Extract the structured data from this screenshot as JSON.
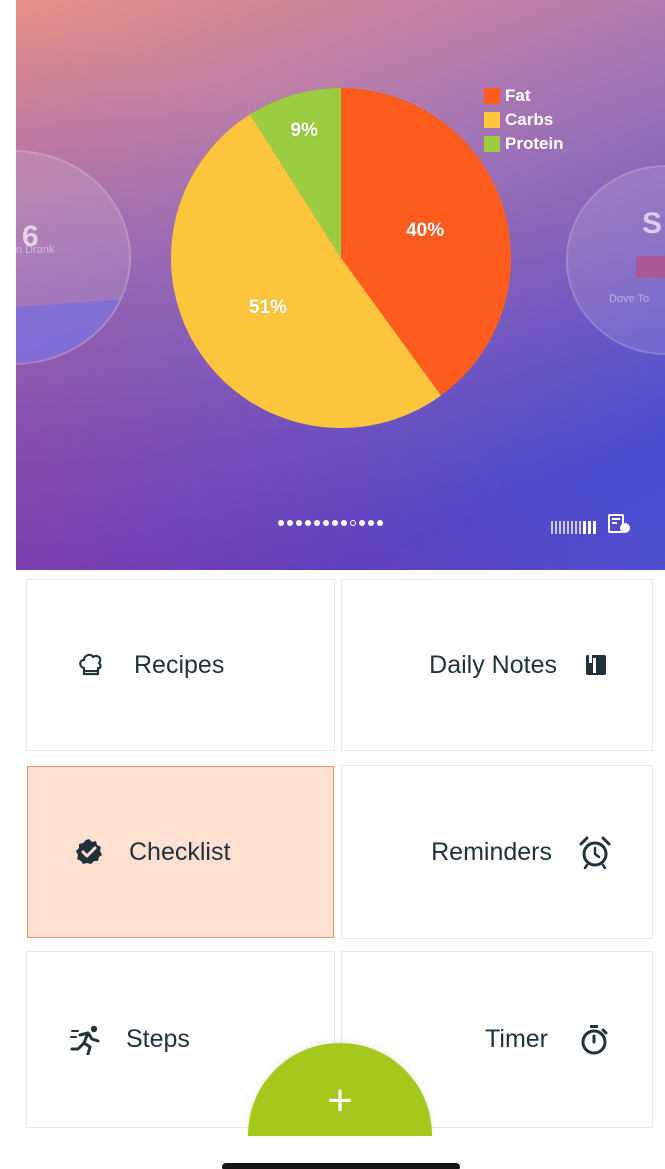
{
  "hero": {
    "left_card": {
      "value": "6",
      "caption": "n Drank"
    },
    "right_card": {
      "value": "S",
      "caption": "Dove To"
    }
  },
  "chart_data": {
    "type": "pie",
    "categories": [
      "Fat",
      "Carbs",
      "Protein"
    ],
    "values": [
      40,
      51,
      9
    ],
    "labels": [
      "40%",
      "51%",
      "9%"
    ],
    "colors": [
      "#fe5b1f",
      "#fdc53b",
      "#9ccc3f"
    ],
    "legend_position": "top-right"
  },
  "pager": {
    "count": 12,
    "current": 9
  },
  "tiles": [
    {
      "label": "Recipes",
      "icon": "chef-hat-icon",
      "align": "left"
    },
    {
      "label": "Daily Notes",
      "icon": "notebook-icon",
      "align": "right"
    },
    {
      "label": "Checklist",
      "icon": "check-badge-icon",
      "align": "left",
      "active": true
    },
    {
      "label": "Reminders",
      "icon": "alarm-clock-icon",
      "align": "right"
    },
    {
      "label": "Steps",
      "icon": "runner-icon",
      "align": "left"
    },
    {
      "label": "Timer",
      "icon": "stopwatch-icon",
      "align": "right"
    }
  ],
  "fab": {
    "label": "+"
  },
  "colors": {
    "active_tile": "#fde0d2",
    "fab": "#a6c81c",
    "text": "#22323a"
  }
}
